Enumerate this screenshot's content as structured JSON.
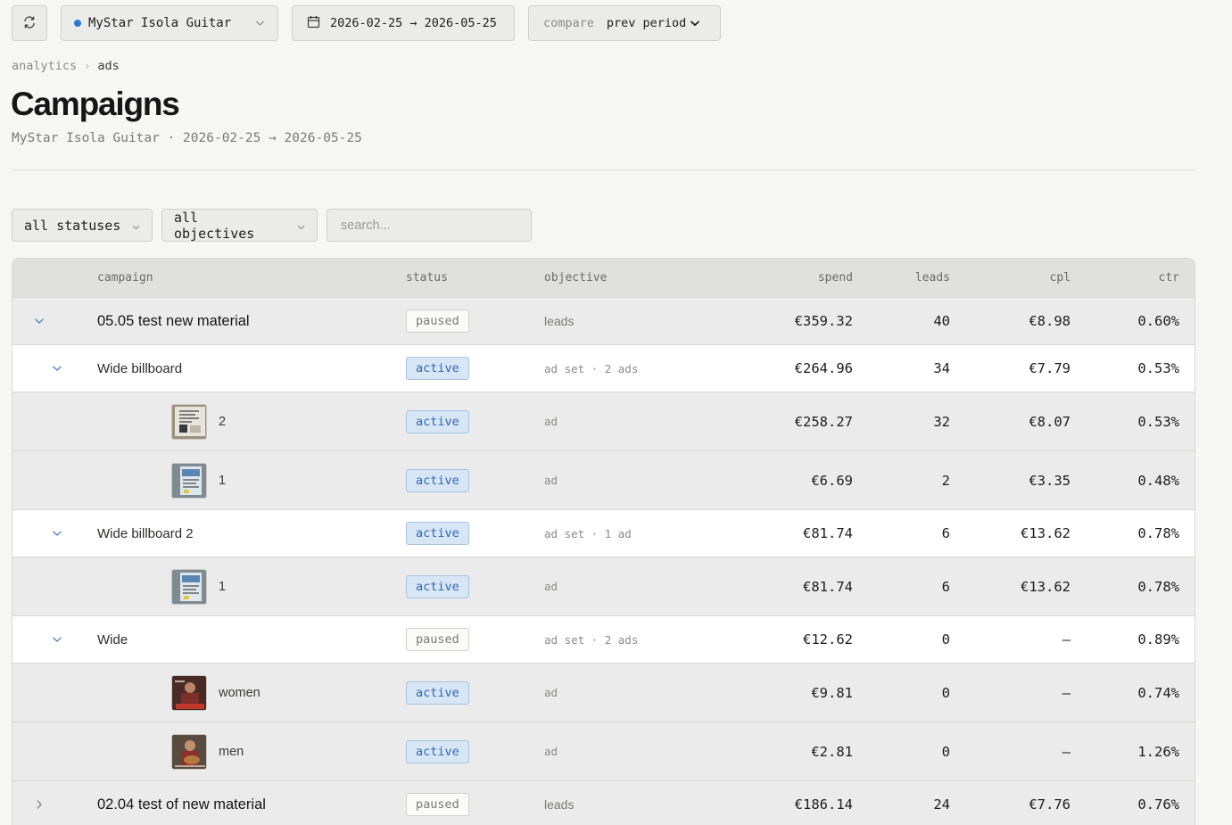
{
  "toolbar": {
    "refresh_icon": "refresh-icon",
    "account_label": "MyStar Isola Guitar",
    "account_dot_color": "#2f79d6",
    "date_range": "2026-02-25 → 2026-05-25",
    "compare_label": "compare",
    "compare_value": "prev period"
  },
  "breadcrumb": {
    "root": "analytics",
    "current": "ads"
  },
  "page": {
    "title": "Campaigns",
    "subtitle": "MyStar Isola Guitar · 2026-02-25 → 2026-05-25"
  },
  "filters": {
    "status": "all statuses",
    "objective": "all objectives",
    "search_placeholder": "search..."
  },
  "table": {
    "headers": {
      "campaign": "campaign",
      "status": "status",
      "objective": "objective",
      "spend": "spend",
      "leads": "leads",
      "cpl": "cpl",
      "ctr": "ctr"
    },
    "rows": [
      {
        "level": "campaign",
        "name": "05.05 test new material",
        "status": "paused",
        "objective": "leads",
        "spend": "€359.32",
        "leads": "40",
        "cpl": "€8.98",
        "ctr": "0.60%",
        "expanded": true
      },
      {
        "level": "adset",
        "name": "Wide billboard",
        "status": "active",
        "objective": "ad set · 2 ads",
        "spend": "€264.96",
        "leads": "34",
        "cpl": "€7.79",
        "ctr": "0.53%",
        "expanded": true
      },
      {
        "level": "ad",
        "name": "2",
        "status": "active",
        "objective": "ad",
        "spend": "€258.27",
        "leads": "32",
        "cpl": "€8.07",
        "ctr": "0.53%",
        "thumb": "billboard"
      },
      {
        "level": "ad",
        "name": "1",
        "status": "active",
        "objective": "ad",
        "spend": "€6.69",
        "leads": "2",
        "cpl": "€3.35",
        "ctr": "0.48%",
        "thumb": "billboard-blue"
      },
      {
        "level": "adset",
        "name": "Wide billboard 2",
        "status": "active",
        "objective": "ad set · 1 ad",
        "spend": "€81.74",
        "leads": "6",
        "cpl": "€13.62",
        "ctr": "0.78%",
        "expanded": true
      },
      {
        "level": "ad",
        "name": "1",
        "status": "active",
        "objective": "ad",
        "spend": "€81.74",
        "leads": "6",
        "cpl": "€13.62",
        "ctr": "0.78%",
        "thumb": "billboard-blue"
      },
      {
        "level": "adset",
        "name": "Wide",
        "status": "paused",
        "objective": "ad set · 2 ads",
        "spend": "€12.62",
        "leads": "0",
        "cpl": "—",
        "ctr": "0.89%",
        "expanded": true
      },
      {
        "level": "ad",
        "name": "women",
        "status": "active",
        "objective": "ad",
        "spend": "€9.81",
        "leads": "0",
        "cpl": "—",
        "ctr": "0.74%",
        "thumb": "guitar-red"
      },
      {
        "level": "ad",
        "name": "men",
        "status": "active",
        "objective": "ad",
        "spend": "€2.81",
        "leads": "0",
        "cpl": "—",
        "ctr": "1.26%",
        "thumb": "guitar-man"
      },
      {
        "level": "campaign",
        "name": "02.04 test of new material",
        "status": "paused",
        "objective": "leads",
        "spend": "€186.14",
        "leads": "24",
        "cpl": "€7.76",
        "ctr": "0.76%",
        "expanded": false
      }
    ]
  }
}
